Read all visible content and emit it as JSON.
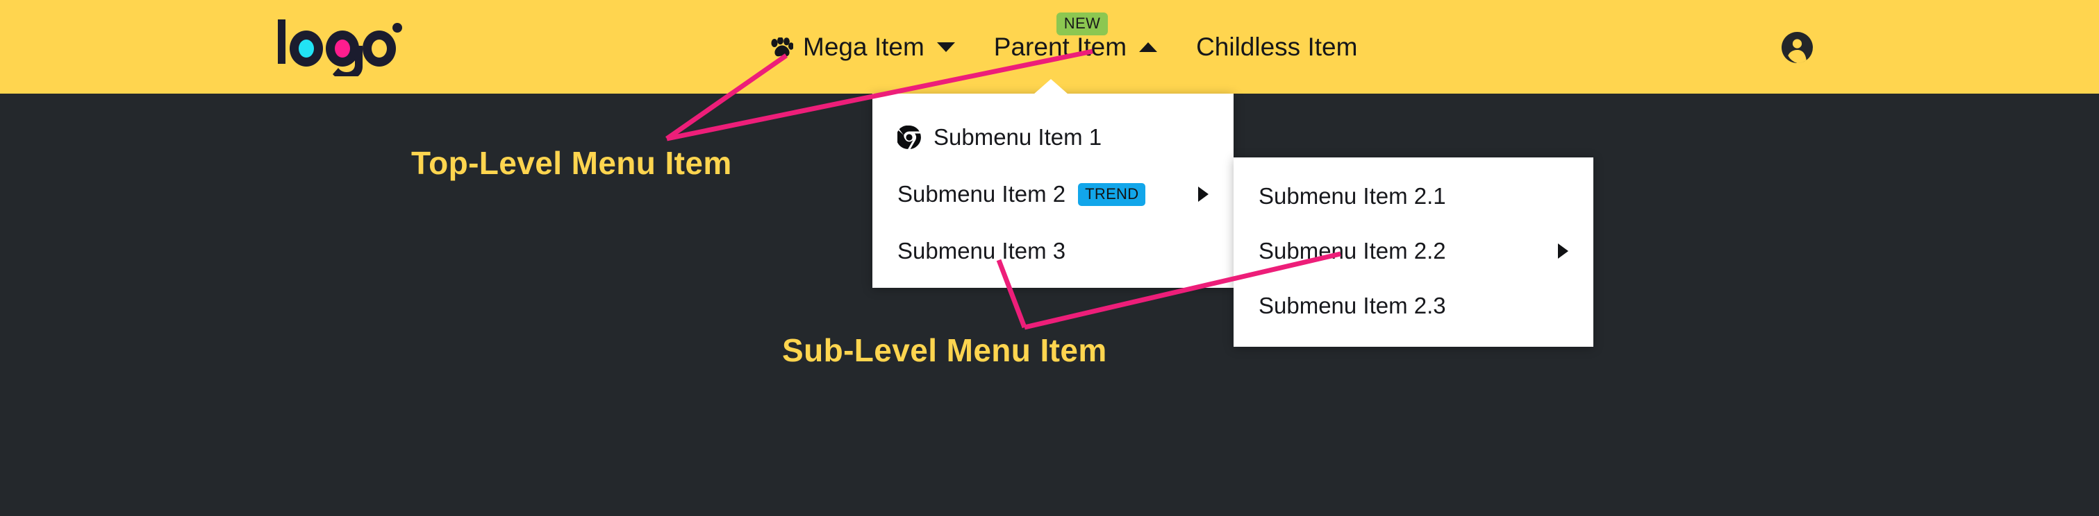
{
  "theme": {
    "header_bg": "#ffd54f",
    "page_bg": "#24282c",
    "menu_bg": "#ffffff",
    "annotation_color": "#ffd54f",
    "arrow_color": "#ed1e79",
    "badge_new_bg": "#8cc751",
    "badge_trend_bg": "#12a6ea",
    "text_dark": "#15161a"
  },
  "header": {
    "logo": {
      "text": "logo",
      "name": "site-logo",
      "accent_cyan": "#22e3f5",
      "accent_magenta": "#ff1d8e",
      "ink": "#1b1c2e"
    },
    "nav": [
      {
        "label": "Mega Item",
        "icon": "paw-icon",
        "caret": "chevron-down-icon",
        "badge": null
      },
      {
        "label": "Parent Item",
        "icon": null,
        "caret": "chevron-up-icon",
        "badge": "NEW"
      },
      {
        "label": "Childless Item",
        "icon": null,
        "caret": null,
        "badge": null
      }
    ],
    "account": {
      "name": "account-icon",
      "label": "Account"
    }
  },
  "dropdown_level1": {
    "items": [
      {
        "label": "Submenu Item 1",
        "icon": "chrome-icon",
        "badge": null,
        "has_submenu": false
      },
      {
        "label": "Submenu Item 2",
        "icon": null,
        "badge": "TREND",
        "has_submenu": true
      },
      {
        "label": "Submenu Item 3",
        "icon": null,
        "badge": null,
        "has_submenu": false
      }
    ]
  },
  "dropdown_level2": {
    "items": [
      {
        "label": "Submenu Item 2.1",
        "has_submenu": false
      },
      {
        "label": "Submenu Item 2.2",
        "has_submenu": true
      },
      {
        "label": "Submenu Item 2.3",
        "has_submenu": false
      }
    ]
  },
  "annotations": [
    {
      "text": "Top-Level Menu Item",
      "name": "annotation-top-level"
    },
    {
      "text": "Sub-Level Menu Item",
      "name": "annotation-sub-level"
    }
  ]
}
